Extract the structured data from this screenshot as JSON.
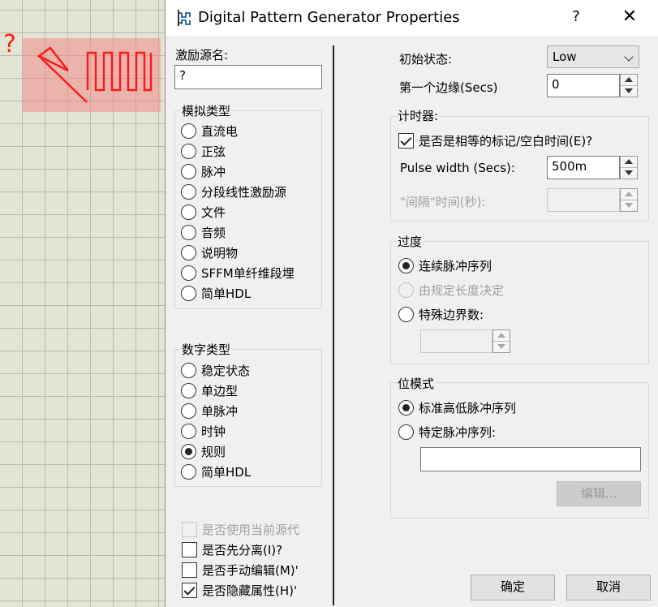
{
  "canvas": {
    "question_mark": "?"
  },
  "window": {
    "title": "Digital Pattern Generator Properties",
    "help": "?",
    "close": "✕"
  },
  "left": {
    "source_name_label": "激励源名:",
    "source_name_value": "?",
    "analog_group": {
      "title": "模拟类型",
      "options": [
        "直流电",
        "正弦",
        "脉冲",
        "分段线性激励源",
        "文件",
        "音频",
        "说明物",
        "SFFM单纤维段埋",
        "简单HDL"
      ]
    },
    "digital_group": {
      "title": "数字类型",
      "options": [
        "稳定状态",
        "单边型",
        "单脉冲",
        "时钟",
        "规则",
        "简单HDL"
      ],
      "selected_index": 4
    },
    "checks": [
      {
        "label": "是否使用当前源代",
        "checked": false,
        "disabled": true
      },
      {
        "label": "是否先分离(I)?",
        "checked": false,
        "disabled": false
      },
      {
        "label": "是否手动编辑(M)'",
        "checked": false,
        "disabled": false
      },
      {
        "label": "是否隐藏属性(H)'",
        "checked": true,
        "disabled": false
      }
    ]
  },
  "right": {
    "initial_state_label": "初始状态:",
    "initial_state_value": "Low",
    "first_edge_label": "第一个边缘(Secs)",
    "first_edge_value": "0",
    "timer_group": {
      "title": "计时器:",
      "equal_mark_space_label": "是否是相等的标记/空白时间(E)?",
      "equal_mark_space_checked": true,
      "pulse_width_label": "Pulse width (Secs):",
      "pulse_width_value": "500m",
      "space_time_label": "\"间隔\"时间(秒):",
      "space_time_value": ""
    },
    "transition_group": {
      "title": "过度",
      "options": [
        "连续脉冲序列",
        "由规定长度决定",
        "特殊边界数:"
      ],
      "selected_index": 0,
      "disabled_index": 1,
      "edges_value": ""
    },
    "bit_pattern_group": {
      "title": "位模式",
      "options": [
        "标准高低脉冲序列",
        "特定脉冲序列:"
      ],
      "selected_index": 0,
      "pattern_value": "",
      "edit_button": "编辑..."
    }
  },
  "buttons": {
    "ok": "确定",
    "cancel": "取消"
  },
  "colors": {
    "accent_red": "#ff2020",
    "dialog_bg": "#f0f0f0",
    "canvas_bg": "#e3e4d3"
  }
}
